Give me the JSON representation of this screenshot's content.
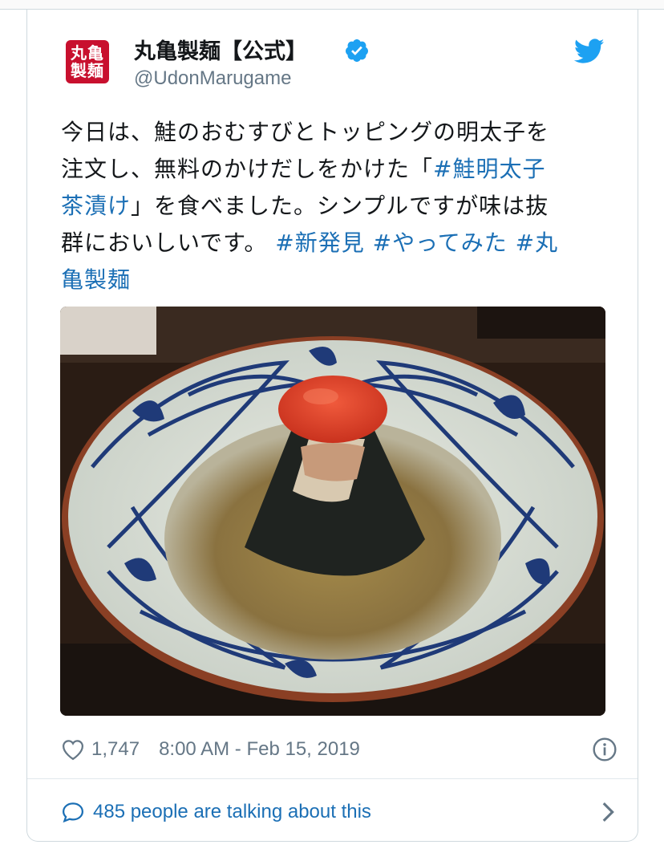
{
  "tweet": {
    "display_name": "丸亀製麺【公式】",
    "handle": "@UdonMarugame",
    "avatar_text": [
      "丸亀",
      "製麺"
    ],
    "text": {
      "line1": "今日は、鮭のおむすびとトッピングの明太子を",
      "line2_plain": "注文し、無料のかけだしをかけた「",
      "line2_tag": "#鮭明太子",
      "line3_tag": "茶漬け",
      "line3_plain": "」を食べました。シンプルですが味は抜",
      "line4_plain": "群においしいです。 ",
      "line4_tag1": "#新発見",
      "line4_tag2": "#やってみた",
      "line4_tag3": "#丸",
      "line5_tag": "亀製麺"
    },
    "likes": "1,747",
    "timestamp": "8:00 AM - Feb 15, 2019",
    "talking": "485 people are talking about this"
  },
  "icons": {
    "verified": "verified-badge-icon",
    "bird": "twitter-bird-icon",
    "heart": "heart-icon",
    "info": "info-icon",
    "bubble": "speech-bubble-icon",
    "chevron": "chevron-right-icon"
  },
  "colors": {
    "link": "#1b6fb5",
    "twitter_blue": "#1da1f2",
    "avatar_red": "#c8102e",
    "muted": "#657786"
  }
}
